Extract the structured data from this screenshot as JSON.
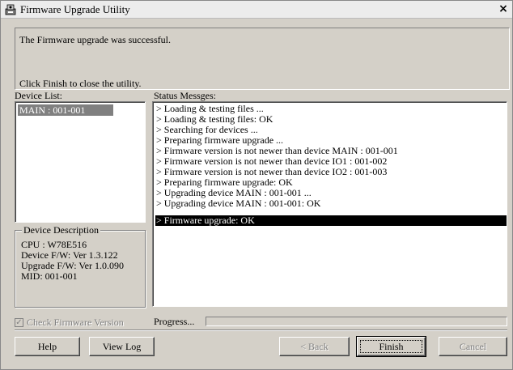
{
  "window": {
    "title": "Firmware Upgrade Utility",
    "close_label": "×"
  },
  "message": {
    "line1": "The Firmware upgrade was successful.",
    "line2": "Click Finish to close the utility."
  },
  "device_list": {
    "label": "Device List:",
    "items": [
      "MAIN : 001-001"
    ],
    "selected_index": 0
  },
  "device_description": {
    "title": "Device Description",
    "lines": [
      "CPU : W78E516",
      "Device F/W: Ver 1.3.122",
      "Upgrade F/W: Ver 1.0.090",
      "MID: 001-001"
    ]
  },
  "status": {
    "label": "Status Messges:",
    "lines": [
      "> Loading & testing files ...",
      "> Loading & testing files: OK",
      "> Searching for devices ...",
      "> Preparing firmware upgrade ...",
      "> Firmware version is not newer than device MAIN : 001-001",
      "> Firmware version is not newer than device IO1 : 001-002",
      "> Firmware version is not newer than device IO2 : 001-003",
      "> Preparing firmware upgrade: OK",
      "> Upgrading device MAIN : 001-001 ...",
      "> Upgrading device MAIN : 001-001: OK",
      "> Firmware upgrade: OK"
    ],
    "selected_index": 10
  },
  "check_firmware": {
    "label": "Check Firmware Version",
    "checked": true,
    "enabled": false
  },
  "progress": {
    "label": "Progress...",
    "value": 0
  },
  "buttons": {
    "help": "Help",
    "view_log": "View Log",
    "back": "< Back",
    "finish": "Finish",
    "cancel": "Cancel"
  },
  "colors": {
    "selection_bg": "#000000",
    "device_selection_bg": "#808080",
    "window_bg": "#d4d0c8"
  },
  "icons": {
    "app": "firmware-app-icon",
    "close": "close-icon",
    "check": "checkmark-icon"
  }
}
